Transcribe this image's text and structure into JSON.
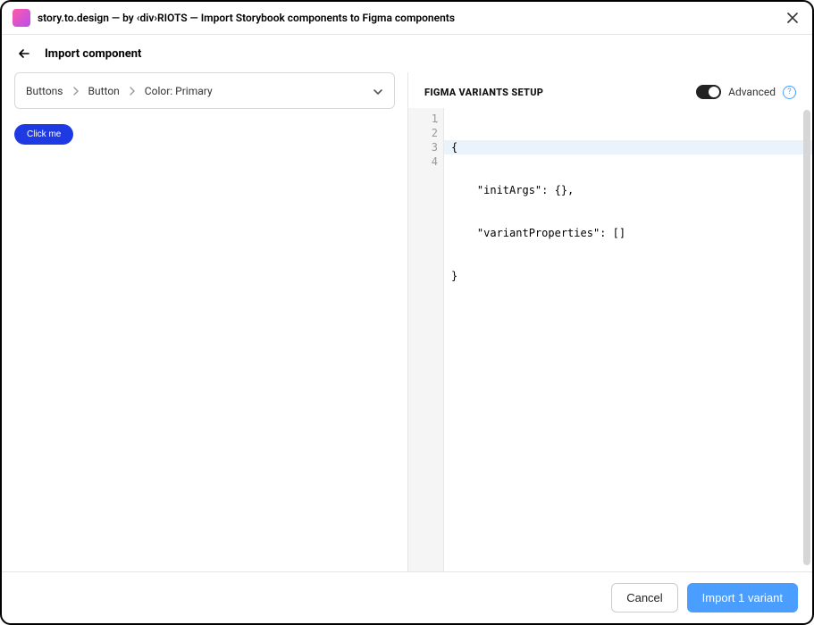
{
  "titlebar": {
    "title": "story.to.design — by ‹div›RIOTS — Import Storybook components to Figma components"
  },
  "subheader": {
    "title": "Import component"
  },
  "breadcrumb": {
    "items": [
      "Buttons",
      "Button",
      "Color: Primary"
    ]
  },
  "preview": {
    "button_label": "Click me"
  },
  "right": {
    "title": "FIGMA VARIANTS SETUP",
    "advanced_label": "Advanced",
    "help_glyph": "?"
  },
  "editor": {
    "line_numbers": [
      "1",
      "2",
      "3",
      "4"
    ],
    "lines": [
      "{",
      "    \"initArgs\": {},",
      "    \"variantProperties\": []",
      "}"
    ]
  },
  "footer": {
    "cancel": "Cancel",
    "import": "Import 1 variant"
  }
}
